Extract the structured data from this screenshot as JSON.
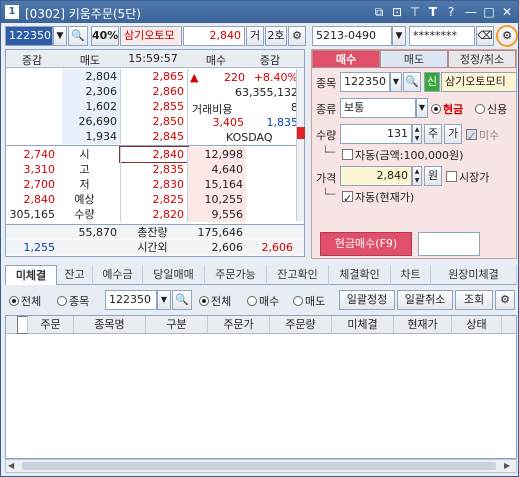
{
  "window": {
    "number": "1",
    "title": "[0302] 키움주문(5단)"
  },
  "titlebar_icons": [
    "restore-icon",
    "link-icon",
    "pin-icon",
    "font-size-icon",
    "help-icon",
    "minimize-icon",
    "maximize-icon",
    "close-icon"
  ],
  "titlebar_glyphs": {
    "font": "T",
    "help": "?",
    "min": "—",
    "max": "□",
    "close": "✕"
  },
  "toolbar": {
    "stock_code": "122350",
    "margin_rate": "40%",
    "stock_name": "삼기오토모",
    "price": "2,840",
    "trade_label": "거",
    "ho_label": "2호",
    "account": "5213-0490",
    "password": "********"
  },
  "orderbook": {
    "headers": [
      "증감",
      "매도",
      "15:59:57",
      "매수",
      "증감"
    ],
    "asks": [
      {
        "qty": "2,804",
        "price": "2,865"
      },
      {
        "qty": "2,306",
        "price": "2,860"
      },
      {
        "qty": "1,602",
        "price": "2,855"
      },
      {
        "qty": "26,690",
        "price": "2,850"
      },
      {
        "qty": "1,934",
        "price": "2,845"
      }
    ],
    "info": {
      "change": "220",
      "change_rate": "+8.40%",
      "volume": "63,355,132",
      "cost_label": "거래비용",
      "cost_value": "8",
      "ref_price": "3,405",
      "ref_qty": "1,835",
      "market": "KOSDAQ"
    },
    "bids": [
      {
        "price": "2,840",
        "label": "시",
        "label_value": "2,740",
        "qty": "12,998"
      },
      {
        "price": "2,835",
        "label": "고",
        "label_value": "3,310",
        "qty": "4,640"
      },
      {
        "price": "2,830",
        "label": "저",
        "label_value": "2,700",
        "qty": "15,164"
      },
      {
        "price": "2,825",
        "label": "예상",
        "label_value": "2,840",
        "qty": "10,255"
      },
      {
        "price": "2,820",
        "label": "수량",
        "label_value": "305,165",
        "qty": "9,556"
      }
    ],
    "total_ask": "55,870",
    "total_label": "총잔량",
    "total_bid": "175,646",
    "after_left": "1,255",
    "after_label": "시간외",
    "after_bid": "2,606",
    "after_right": "2,606"
  },
  "order_panel": {
    "tabs": [
      "매수",
      "매도",
      "정정/취소"
    ],
    "stock_label": "종목",
    "stock_code": "122350",
    "stock_badge": "신",
    "stock_name": "삼기오토모티",
    "type_label": "종류",
    "type_value": "보통",
    "cash_label": "현금",
    "credit_label": "신용",
    "qty_label": "수량",
    "qty_value": "131",
    "qty_unit": "주",
    "qty_btn": "가",
    "unfilled_label": "미수",
    "auto_amount_label": "자동(금액:100,000원)",
    "price_label": "가격",
    "price_value": "2,840",
    "price_unit": "원",
    "market_price_label": "시장가",
    "auto_current_label": "자동(현재가)",
    "buy_button": "현금매수(F9)"
  },
  "bottom_tabs": [
    "미체결",
    "잔고",
    "예수금",
    "당일매매",
    "주문가능",
    "잔고확인",
    "체결확인",
    "차트",
    "원장미체결"
  ],
  "filter": {
    "all": "전체",
    "stock": "종목",
    "code": "122350",
    "all2": "전체",
    "buy": "매수",
    "sell": "매도",
    "batch_modify": "일괄정정",
    "batch_cancel": "일괄취소",
    "query": "조회"
  },
  "table_headers": [
    "주문",
    "종목명",
    "구분",
    "주문가",
    "주문량",
    "미체결",
    "현재가",
    "상태"
  ],
  "colors": {
    "up": "#d40000",
    "down": "#0a3fb5",
    "buy_button": "#e0506a",
    "highlight": "#f39a2a"
  }
}
